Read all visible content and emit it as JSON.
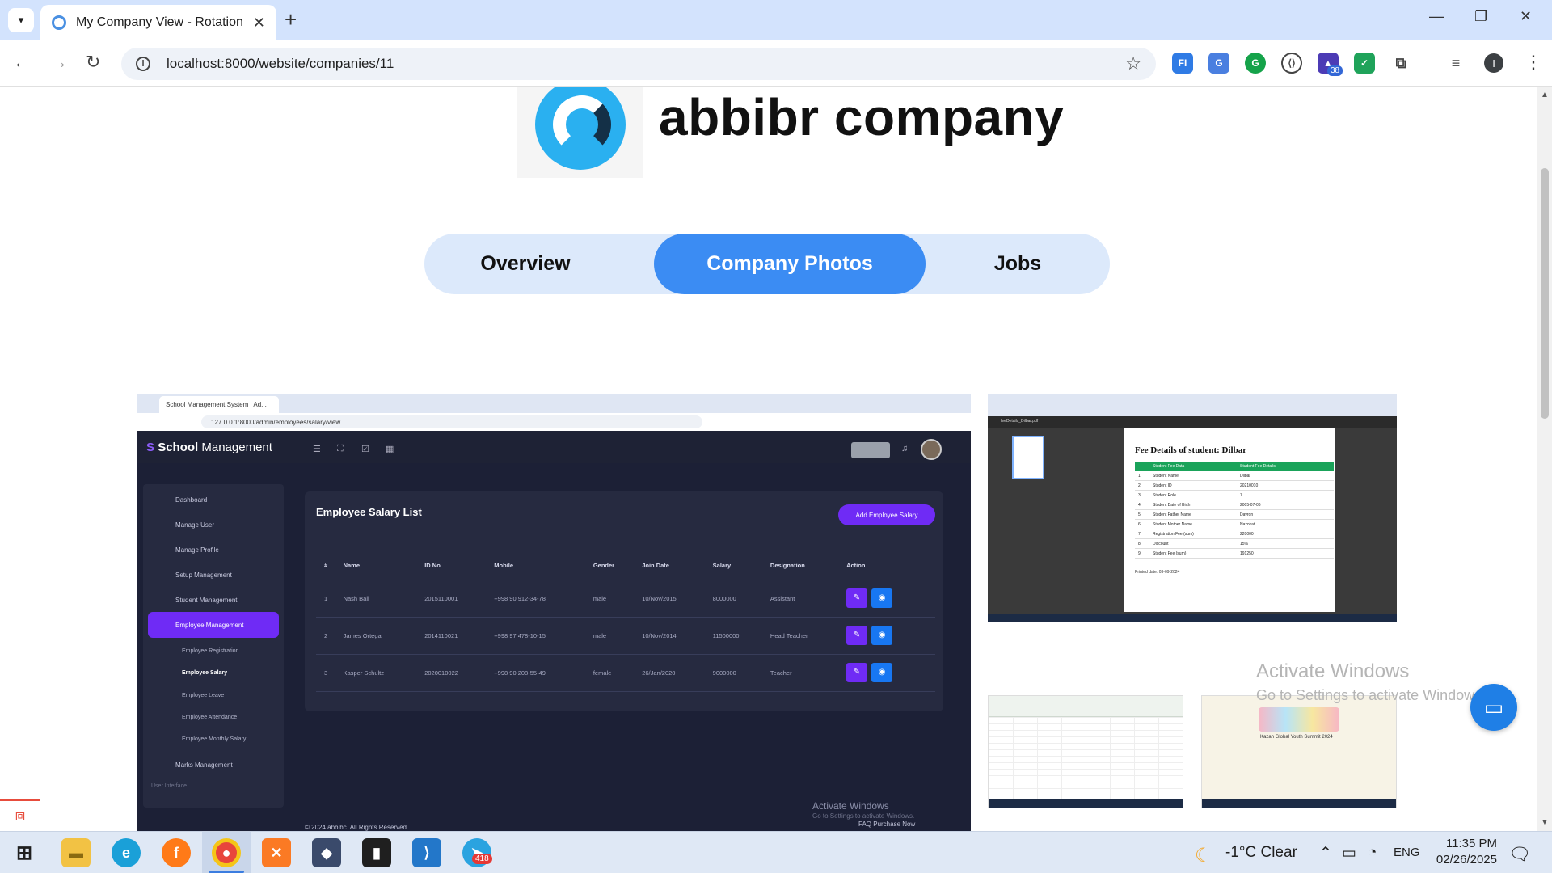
{
  "browser": {
    "tab_title": "My Company View - Rotation",
    "url": "localhost:8000/website/companies/11",
    "extension_badge": "38"
  },
  "company": {
    "name": "abbibr company"
  },
  "nav_tabs": [
    {
      "label": "Overview",
      "active": false
    },
    {
      "label": "Company Photos",
      "active": true
    },
    {
      "label": "Jobs",
      "active": false
    }
  ],
  "photo_main": {
    "tab_title": "School Management System | Ad...",
    "url": "127.0.0.1:8000/admin/employees/salary/view",
    "brand_first": "School",
    "brand_second": " Management",
    "sidebar": [
      {
        "label": "Dashboard"
      },
      {
        "label": "Manage User"
      },
      {
        "label": "Manage Profile"
      },
      {
        "label": "Setup Management"
      },
      {
        "label": "Student Management"
      },
      {
        "label": "Employee Management"
      },
      {
        "label": "Marks Management"
      }
    ],
    "submenu": [
      {
        "label": "Employee Registration"
      },
      {
        "label": "Employee Salary"
      },
      {
        "label": "Employee Leave"
      },
      {
        "label": "Employee Attendance"
      },
      {
        "label": "Employee Monthly Salary"
      }
    ],
    "sidebar_footer_label": "User Interface",
    "card_title": "Employee Salary List",
    "add_button": "Add Employee Salary",
    "table_headers": [
      "#",
      "Name",
      "ID No",
      "Mobile",
      "Gender",
      "Join Date",
      "Salary",
      "Designation",
      "Action"
    ],
    "rows": [
      [
        "1",
        "Nash Ball",
        "2015110001",
        "+998 90 912-34-78",
        "male",
        "10/Nov/2015",
        "8000000",
        "Assistant"
      ],
      [
        "2",
        "James Ortega",
        "2014110021",
        "+998 97 478-10-15",
        "male",
        "10/Nov/2014",
        "11500000",
        "Head Teacher"
      ],
      [
        "3",
        "Kasper Schultz",
        "2020010022",
        "+998 90 208-55-49",
        "female",
        "26/Jan/2020",
        "9000000",
        "Teacher"
      ]
    ],
    "watermark_line1": "Activate Windows",
    "watermark_line2": "Go to Settings to activate Windows.",
    "footer_copy": "© 2024 abbibc. All Rights Reserved.",
    "footer_links": "FAQ    Purchase Now"
  },
  "photo_pdf": {
    "file_name": "feeDetails_Dilbar.pdf",
    "title": "Fee Details of student: Dilbar",
    "col1": "Student Fee Data",
    "col2": "Student Fee Details",
    "rows": [
      [
        "1",
        "Student Name",
        "Dilbar"
      ],
      [
        "2",
        "Student ID",
        "20210010"
      ],
      [
        "3",
        "Student Role",
        "7"
      ],
      [
        "4",
        "Student Date of Birth",
        "2005-07-06"
      ],
      [
        "5",
        "Student Father Name",
        "Davron"
      ],
      [
        "6",
        "Student Mother Name",
        "Nazokat"
      ],
      [
        "7",
        "Registration Fee (sum)",
        "220000"
      ],
      [
        "8",
        "Discount",
        "15%"
      ],
      [
        "9",
        "Student Fee (sum)",
        "191250"
      ]
    ],
    "printed": "Printed date: 03-09-2024"
  },
  "photo_summit": {
    "caption": "Kazan Global Youth Summit 2024"
  },
  "overlay": {
    "activate_line1": "Activate Windows",
    "activate_line2": "Go to Settings to activate Windows."
  },
  "taskbar": {
    "telegram_badge": "418",
    "weather": "-1°C  Clear",
    "language": "ENG",
    "time": "11:35 PM",
    "date": "02/26/2025"
  }
}
